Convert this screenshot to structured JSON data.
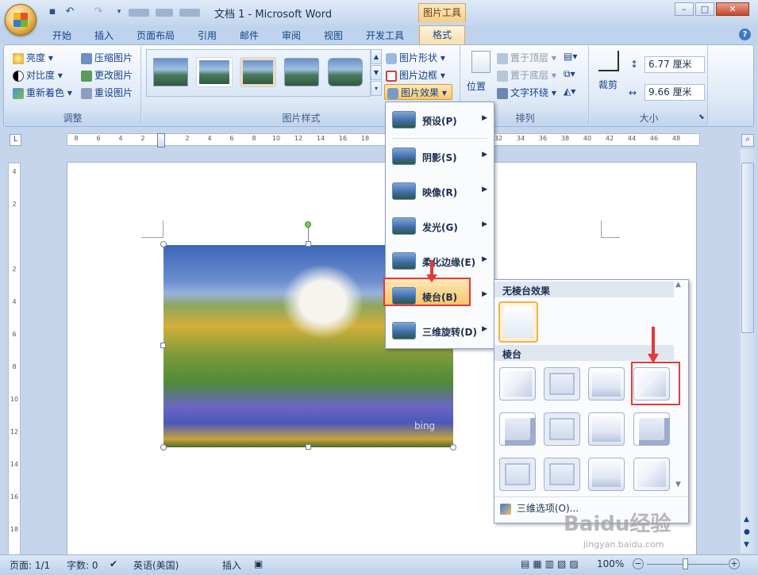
{
  "window": {
    "title": "文档 1 - Microsoft Word",
    "context_tab": "图片工具"
  },
  "tabs": [
    "开始",
    "插入",
    "页面布局",
    "引用",
    "邮件",
    "审阅",
    "视图",
    "开发工具",
    "格式"
  ],
  "adjust": {
    "label": "调整",
    "brightness": "亮度",
    "contrast": "对比度",
    "recolor": "重新着色",
    "compress": "压缩图片",
    "change": "更改图片",
    "reset": "重设图片"
  },
  "styles": {
    "label": "图片样式",
    "shape": "图片形状",
    "border": "图片边框",
    "effects": "图片效果"
  },
  "arrange": {
    "label": "排列",
    "position": "位置",
    "front": "置于顶层",
    "back": "置于底层",
    "wrap": "文字环绕"
  },
  "size": {
    "label": "大小",
    "crop": "裁剪",
    "height": "6.77 厘米",
    "width": "9.66 厘米"
  },
  "ruler": {
    "h": [
      "8",
      "6",
      "4",
      "2",
      "",
      "2",
      "4",
      "6",
      "8",
      "10",
      "12",
      "14",
      "16",
      "18",
      "",
      "",
      "",
      "",
      "",
      "32",
      "34",
      "36",
      "38",
      "40",
      "42",
      "44",
      "46",
      "48"
    ],
    "v": [
      "4",
      "2",
      "",
      "2",
      "4",
      "6",
      "8",
      "10",
      "12",
      "14",
      "16",
      "18"
    ]
  },
  "menu": {
    "items": [
      "预设(P)",
      "阴影(S)",
      "映像(R)",
      "发光(G)",
      "柔化边缘(E)",
      "棱台(B)",
      "三维旋转(D)"
    ]
  },
  "submenu": {
    "none_header": "无棱台效果",
    "bevel_header": "棱台",
    "options": "三维选项(O)..."
  },
  "status": {
    "page": "页面: 1/1",
    "words": "字数: 0",
    "lang": "英语(美国)",
    "mode": "插入",
    "zoom": "100%"
  },
  "watermark": {
    "main": "Baidu经验",
    "sub": "jingyan.baidu.com"
  }
}
